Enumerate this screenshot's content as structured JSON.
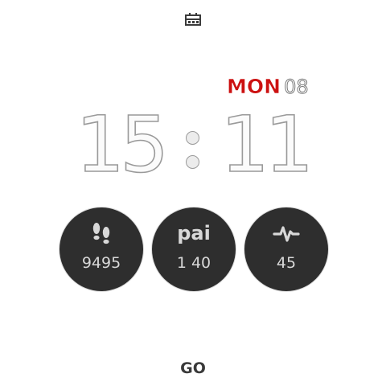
{
  "status_icon": "calendar-icon",
  "date": {
    "weekday": "MON",
    "day": "08"
  },
  "time": {
    "hours": "15",
    "minutes": "11"
  },
  "widgets": [
    {
      "icon": "footsteps-icon",
      "value": "9495"
    },
    {
      "label": "pai",
      "value": "1 40"
    },
    {
      "icon": "heart-rate-icon",
      "value": "45"
    }
  ],
  "bottom_label": "GO",
  "colors": {
    "accent": "#cc1111",
    "widget_bg": "#2e2e2e",
    "widget_text": "#d8d8d8"
  }
}
